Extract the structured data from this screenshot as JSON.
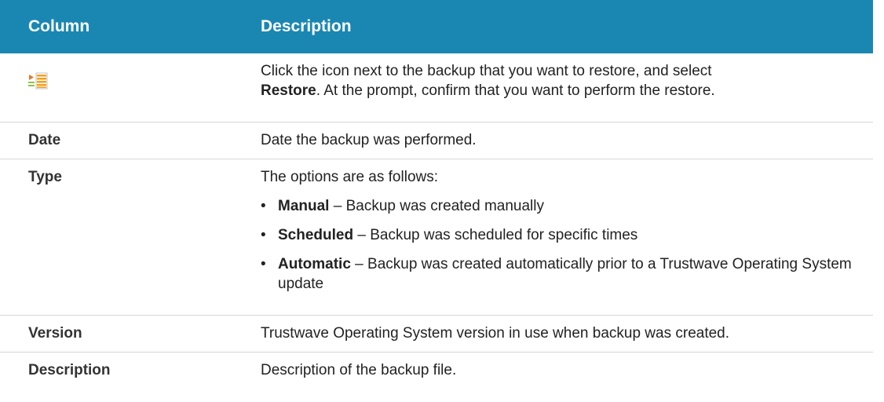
{
  "header": {
    "col1": "Column",
    "col2": "Description"
  },
  "rows": {
    "icon_row": {
      "icon": "restore-menu-icon",
      "desc_part1": "Click the icon next to the backup that you want to restore, and select",
      "desc_bold": "Restore",
      "desc_part2": ". At the prompt, confirm that you want to perform the restore."
    },
    "date": {
      "label": "Date",
      "desc": "Date the backup was performed."
    },
    "type": {
      "label": "Type",
      "intro": "The options are as follows:",
      "options": [
        {
          "name": "Manual",
          "text": " – Backup was created manually"
        },
        {
          "name": "Scheduled",
          "text": " – Backup was scheduled for specific times"
        },
        {
          "name": "Automatic",
          "text": " – Backup was created automatically prior to a Trustwave Operating System update"
        }
      ]
    },
    "version": {
      "label": "Version",
      "desc": "Trustwave Operating System version in use when backup was created."
    },
    "description": {
      "label": "Description",
      "desc": "Description of the backup file."
    }
  },
  "colors": {
    "header_bg": "#1a87b3",
    "header_text": "#ffffff",
    "divider": "#d6d6d6"
  }
}
